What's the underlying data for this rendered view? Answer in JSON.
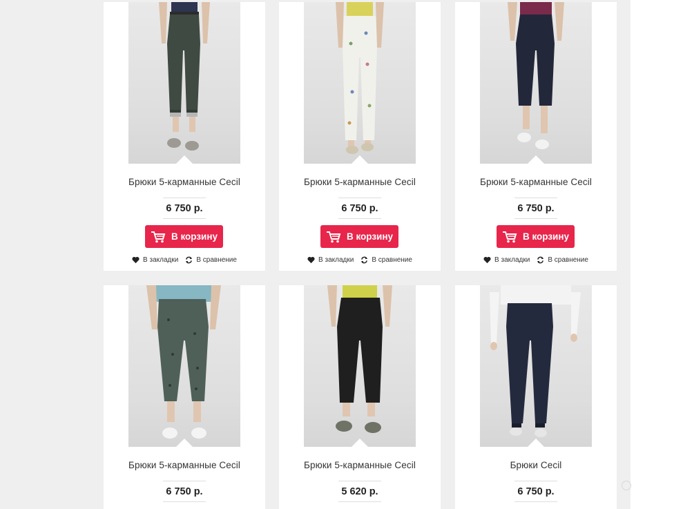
{
  "colors": {
    "accent": "#e8254b",
    "page_background": "#efefef",
    "card_background": "#ffffff"
  },
  "products": [
    {
      "title": "Брюки 5-карманные Cecil",
      "price": "6 750 р.",
      "cart_label": "В корзину",
      "bookmark_label": "В закладки",
      "compare_label": "В сравнение",
      "pants_color": "#3f4a42",
      "top_color": "#2e3550",
      "image": "dark-green-capri-pants"
    },
    {
      "title": "Брюки 5-карманные Cecil",
      "price": "6 750 р.",
      "cart_label": "В корзину",
      "bookmark_label": "В закладки",
      "compare_label": "В сравнение",
      "pants_color": "#f1f1ec",
      "top_color": "#d9d25a",
      "image": "white-floral-pants"
    },
    {
      "title": "Брюки 5-карманные Cecil",
      "price": "6 750 р.",
      "cart_label": "В корзину",
      "bookmark_label": "В закладки",
      "compare_label": "В сравнение",
      "pants_color": "#23273a",
      "top_color": "#7a2a4a",
      "image": "navy-capri-pants"
    },
    {
      "title": "Брюки 5-карманные Cecil",
      "price": "6 750 р.",
      "pants_color": "#4f6058",
      "top_color": "#86b7c2",
      "image": "green-print-capri-pants"
    },
    {
      "title": "Брюки 5-карманные Cecil",
      "price": "5 620 р.",
      "pants_color": "#1f1f1f",
      "top_color": "#cfd14a",
      "image": "black-capri-pants"
    },
    {
      "title": "Брюки Cecil",
      "price": "6 750 р.",
      "pants_color": "#242a3e",
      "top_color": "#f3f3f3",
      "image": "navy-slim-pants"
    }
  ]
}
